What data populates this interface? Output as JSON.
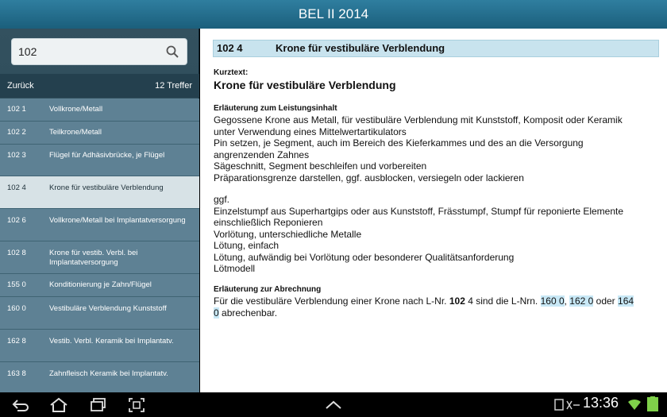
{
  "app": {
    "title": "BEL II 2014"
  },
  "search": {
    "value": "102"
  },
  "nav": {
    "back_label": "Zurück",
    "hits_label": "12 Treffer"
  },
  "list": [
    {
      "code": "102 1",
      "name": "Vollkrone/Metall"
    },
    {
      "code": "102 2",
      "name": "Teilkrone/Metall"
    },
    {
      "code": "102 3",
      "name": "Flügel für Adhäsivbrücke, je Flügel"
    },
    {
      "code": "102 4",
      "name": "Krone für vestibuläre Verblendung",
      "selected": true
    },
    {
      "code": "102 6",
      "name": "Vollkrone/Metall bei Implantatversorgung"
    },
    {
      "code": "102 8",
      "name": "Krone für vestib. Verbl. bei Implantatversorgung"
    },
    {
      "code": "155 0",
      "name": "Konditionierung je Zahn/Flügel"
    },
    {
      "code": "160 0",
      "name": "Vestibuläre Verblendung Kunststoff"
    },
    {
      "code": "162 8",
      "name": "Vestib. Verbl. Keramik bei Implantatv."
    },
    {
      "code": "163 8",
      "name": "Zahnfleisch Keramik bei Implantatv."
    }
  ],
  "detail": {
    "code": "102 4",
    "title": "Krone für vestibuläre Verblendung",
    "short_label": "Kurztext:",
    "short_text": "Krone für vestibuläre Verblendung",
    "content_label": "Erläuterung zum Leistungsinhalt",
    "content_lines": [
      "Gegossene Krone aus Metall, für vestibuläre Verblendung mit Kunststoff, Komposit oder Keramik",
      "unter Verwendung eines Mittelwertartikulators",
      "Pin setzen, je Segment, auch im Bereich des Kieferkammes und des an die Versorgung",
      "angrenzenden Zahnes",
      "Sägeschnitt, Segment beschleifen und vorbereiten",
      "Präparationsgrenze darstellen, ggf. ausblocken, versiegeln oder lackieren"
    ],
    "optional_lines": [
      "ggf.",
      "Einzelstumpf aus Superhartgips oder aus Kunststoff, Frässtumpf, Stumpf für reponierte Elemente",
      "einschließlich Reponieren",
      "Vorlötung, unterschiedliche Metalle",
      "Lötung, einfach",
      "Lötung, aufwändig bei Vorlötung oder besonderer Qualitätsanforderung",
      "Lötmodell"
    ],
    "billing_label": "Erläuterung zur Abrechnung",
    "billing": {
      "p1": "Für die vestibuläre Verblendung einer Krone nach L-Nr. ",
      "b1": "102",
      "p2": " 4 sind die L-Nrn. ",
      "l1": "160 0",
      "s1": ", ",
      "l2": "162 0",
      "s2": " oder ",
      "l3a": "164",
      "l3b": "0",
      "p3": " abrechenbar."
    }
  },
  "statusbar": {
    "time": "13:36"
  }
}
